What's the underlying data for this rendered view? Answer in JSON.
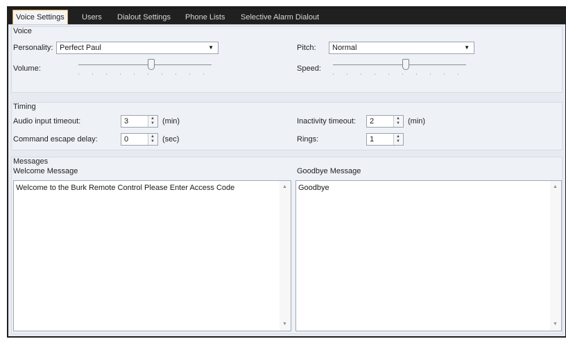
{
  "tabs": [
    {
      "label": "Voice Settings",
      "active": true
    },
    {
      "label": "Users",
      "active": false
    },
    {
      "label": "Dialout Settings",
      "active": false
    },
    {
      "label": "Phone Lists",
      "active": false
    },
    {
      "label": "Selective Alarm Dialout",
      "active": false
    }
  ],
  "voice": {
    "title": "Voice",
    "personality_label": "Personality:",
    "personality_value": "Perfect Paul",
    "pitch_label": "Pitch:",
    "pitch_value": "Normal",
    "volume_label": "Volume:",
    "volume_level": 0.55,
    "speed_label": "Speed:",
    "speed_level": 0.55
  },
  "timing": {
    "title": "Timing",
    "audio_timeout_label": "Audio input timeout:",
    "audio_timeout_value": "3",
    "audio_timeout_unit": "(min)",
    "command_escape_label": "Command escape delay:",
    "command_escape_value": "0",
    "command_escape_unit": "(sec)",
    "inactivity_label": "Inactivity timeout:",
    "inactivity_value": "2",
    "inactivity_unit": "(min)",
    "rings_label": "Rings:",
    "rings_value": "1"
  },
  "messages": {
    "title": "Messages",
    "welcome_label": "Welcome Message",
    "welcome_text": "Welcome to the Burk Remote Control Please Enter Access Code",
    "goodbye_label": "Goodbye Message",
    "goodbye_text": "Goodbye"
  },
  "icons": {
    "dropdown": "chevron-down-icon",
    "spin_up": "spin-up-icon",
    "spin_down": "spin-down-icon",
    "scroll_up": "scroll-up-icon",
    "scroll_down": "scroll-down-icon"
  },
  "colors": {
    "active_tab_border": "#e6a43a",
    "window_frame": "#1c1c1c",
    "panel_bg": "#e7ebf1"
  }
}
